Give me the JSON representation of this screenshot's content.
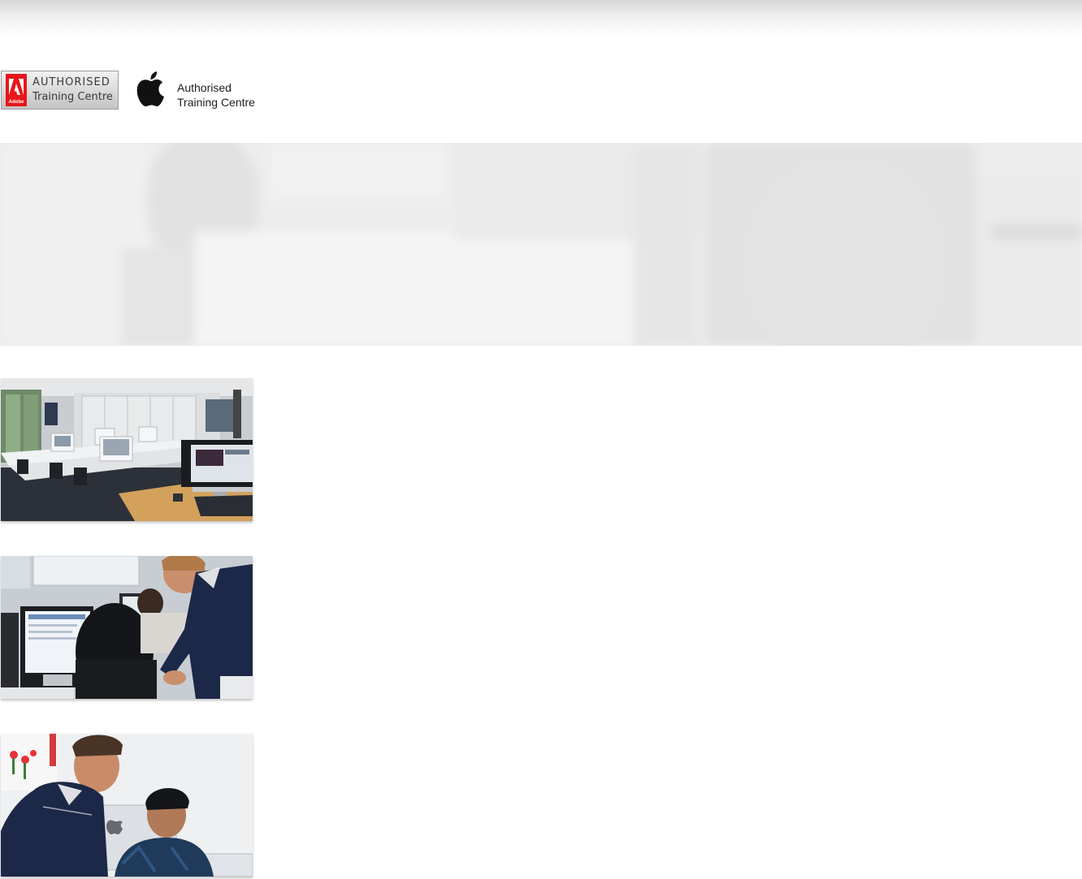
{
  "logos": {
    "adobe": {
      "brand": "Adobe",
      "line1": "AUTHORISED",
      "line2": "Training Centre",
      "brand_color": "#e8161b",
      "icon": "adobe-logo-icon"
    },
    "apple": {
      "line1": "Authorised",
      "line2": "Training Centre",
      "icon": "apple-logo-icon"
    }
  },
  "hero": {
    "image": "faded-classroom-hero-photo"
  },
  "photos": [
    {
      "image": "training-room-with-imacs-photo"
    },
    {
      "image": "instructor-helping-student-photo"
    },
    {
      "image": "instructor-and-student-at-imac-photo"
    }
  ],
  "colors": {
    "instructor_shirt": "#1c2847",
    "desk_wood": "#d3a15c"
  }
}
